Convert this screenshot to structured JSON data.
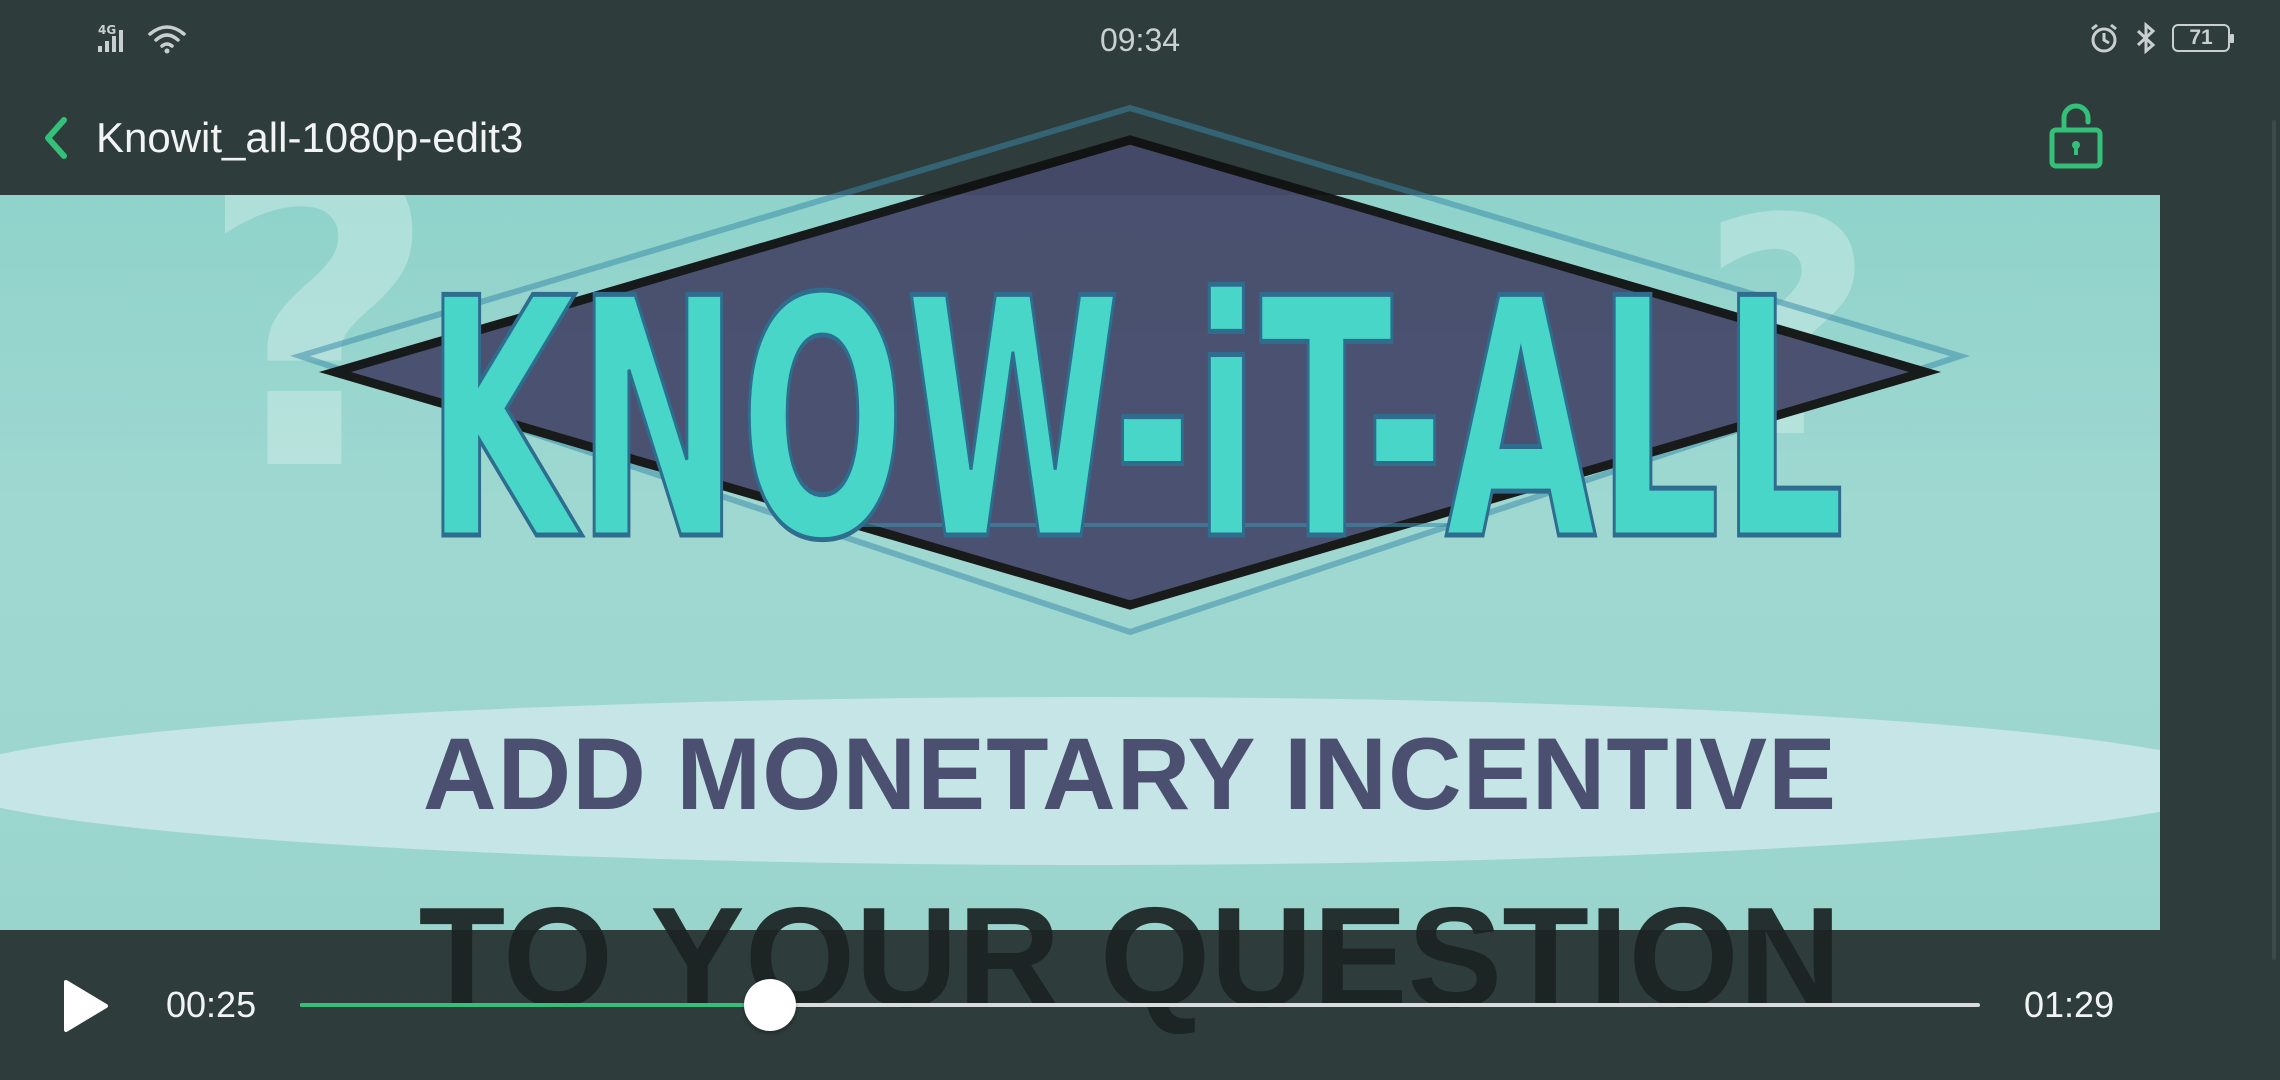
{
  "status_bar": {
    "time": "09:34",
    "network": "4G",
    "battery": "71",
    "icons": [
      "signal-icon",
      "wifi-icon",
      "alarm-icon",
      "bluetooth-icon",
      "battery-icon"
    ]
  },
  "header": {
    "title": "Knowit_all-1080p-edit3",
    "back_icon": "chevron-left-icon",
    "lock_icon": "unlock-icon"
  },
  "video": {
    "logo_text": "KNOW-iT-ALL",
    "caption_line1": "ADD MONETARY INCENTIVE",
    "caption_line2": "TO YOUR QUESTION"
  },
  "player": {
    "current_time": "00:25",
    "total_time": "01:29",
    "progress": 0.28,
    "play_icon": "play-icon"
  },
  "colors": {
    "accent": "#35c07a",
    "background": "#2e3c3c",
    "logo_teal": "#47d6c8",
    "diamond": "#474a6b"
  }
}
